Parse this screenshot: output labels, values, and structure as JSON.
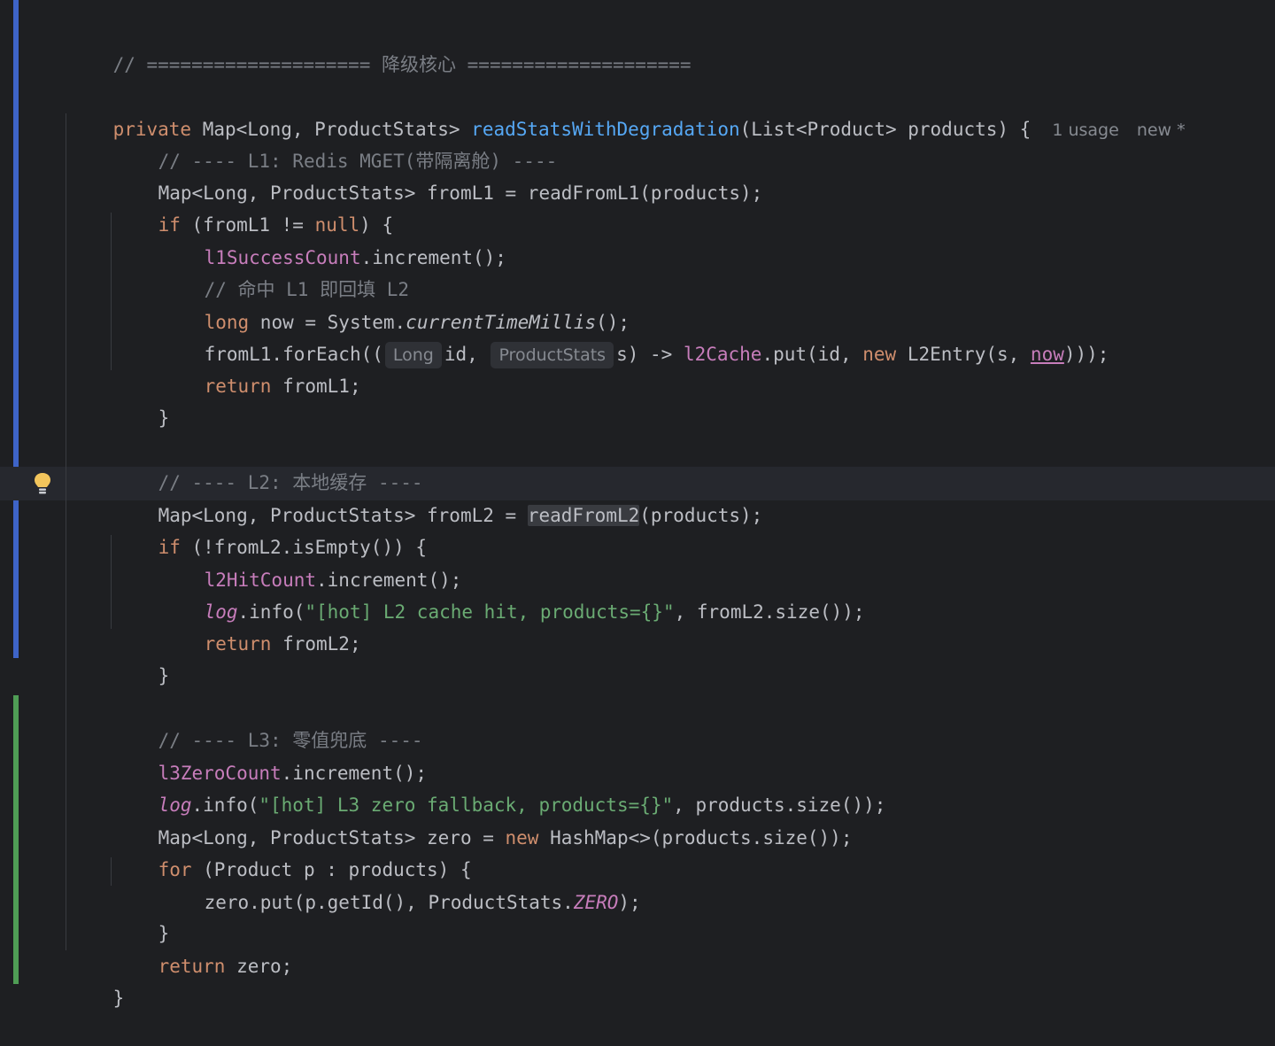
{
  "colors": {
    "background": "#1e1f22",
    "keyword": "#cf8e6d",
    "function": "#56a8f5",
    "field": "#c77dbb",
    "string": "#6aab73",
    "comment": "#7a7e85",
    "text": "#bcbec4",
    "modified_gutter": "#3e64c8",
    "added_gutter": "#4f9d55"
  },
  "icons": {
    "intention_bulb": "lightbulb-icon"
  },
  "code": {
    "l1": "// ==================== 降级核心 ====================",
    "l3": {
      "kw": "private",
      "t1": " Map<Long, ProductStats> ",
      "fn": "readStatsWithDegradation",
      "t2": "(List<Product> products) {",
      "usage": "1 usage",
      "new": "new *"
    },
    "l4": "// ---- L1: Redis MGET(带隔离舱) ----",
    "l5": "Map<Long, ProductStats> fromL1 = readFromL1(products);",
    "l6": {
      "kw": "if",
      "t1": " (fromL1 != ",
      "kw2": "null",
      "t2": ") {"
    },
    "l7": {
      "field": "l1SuccessCount",
      "t": ".increment();"
    },
    "l8": "// 命中 L1 即回填 L2",
    "l9": {
      "kw": "long",
      "t1": " now = System.",
      "it": "currentTimeMillis",
      "t2": "();"
    },
    "l10": {
      "t1": "fromL1.forEach((",
      "hint1": "Long",
      "t2": "id, ",
      "hint2": "ProductStats",
      "t3": "s) -> ",
      "field": "l2Cache",
      "t4": ".put(id, ",
      "kw": "new",
      "t5": " L2Entry(s, ",
      "ul": "now",
      "t6": ")));"
    },
    "l11": {
      "kw": "return",
      "t": " fromL1;"
    },
    "l12": "}",
    "l14": "// ---- L2: 本地缓存 ----",
    "l15": {
      "t1": "Map<Long, ProductStats> fromL2 = ",
      "hl": "readFromL2",
      "t2": "(products);"
    },
    "l16": {
      "kw": "if",
      "t": " (!fromL2.isEmpty()) {"
    },
    "l17": {
      "field": "l2HitCount",
      "t": ".increment();"
    },
    "l18": {
      "field": "log",
      "t1": ".info(",
      "str": "\"[hot] L2 cache hit, products={}\"",
      "t2": ", fromL2.size());"
    },
    "l19": {
      "kw": "return",
      "t": " fromL2;"
    },
    "l20": "}",
    "l22": "// ---- L3: 零值兜底 ----",
    "l23": {
      "field": "l3ZeroCount",
      "t": ".increment();"
    },
    "l24": {
      "field": "log",
      "t1": ".info(",
      "str": "\"[hot] L3 zero fallback, products={}\"",
      "t2": ", products.size());"
    },
    "l25": {
      "t1": "Map<Long, ProductStats> zero = ",
      "kw": "new",
      "t2": " HashMap<>(products.size());"
    },
    "l26": {
      "kw": "for",
      "t": " (Product p : products) {"
    },
    "l27": {
      "t1": "zero.put(p.getId(), ProductStats.",
      "it": "ZERO",
      "t2": ");"
    },
    "l28": "}",
    "l29": {
      "kw": "return",
      "t": " zero;"
    },
    "l30": "}"
  }
}
